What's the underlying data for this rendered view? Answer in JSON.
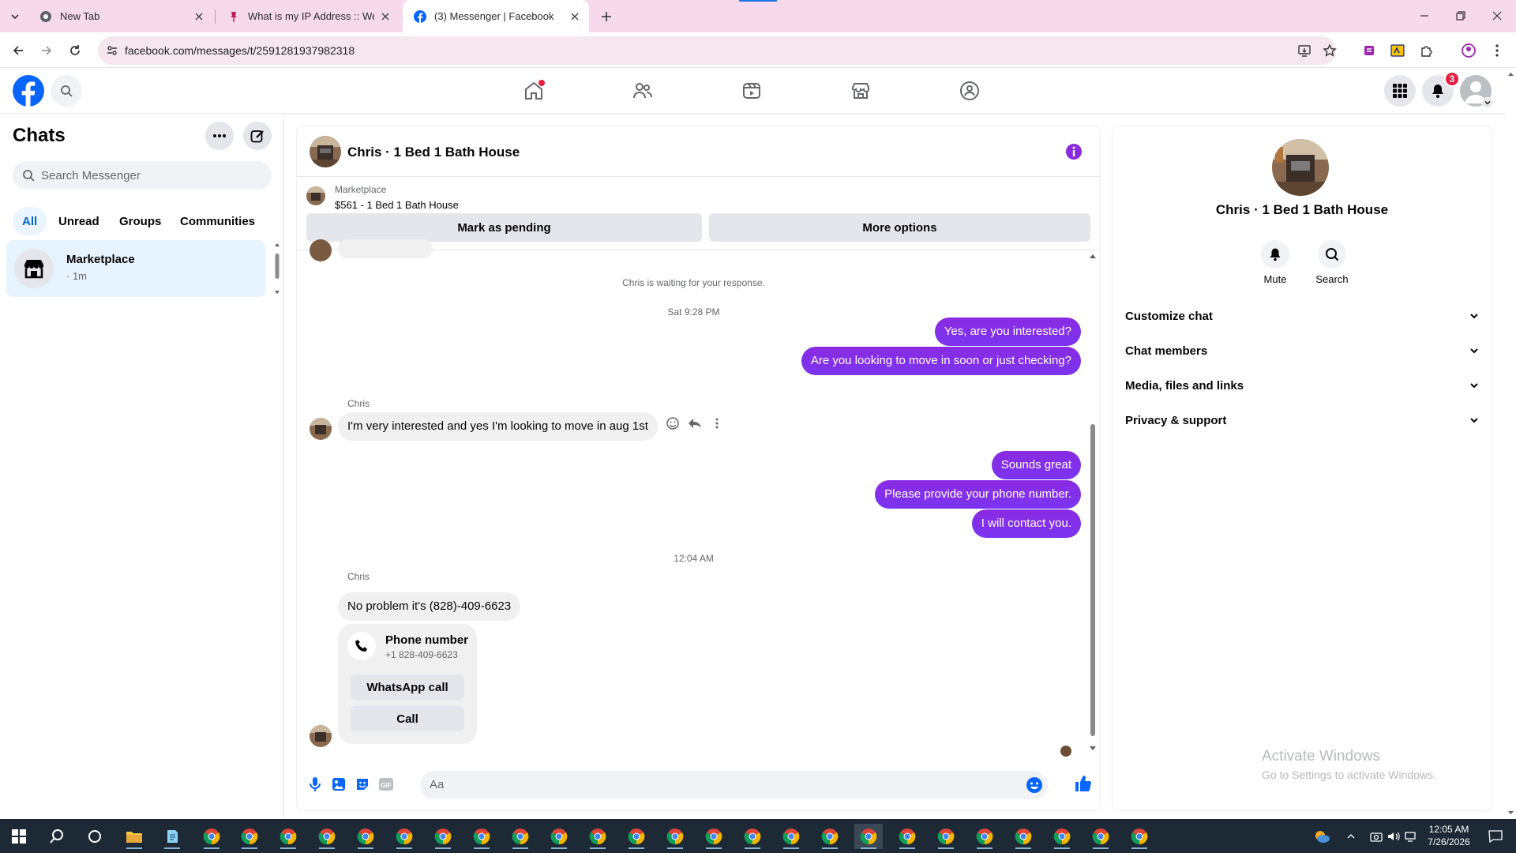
{
  "browser": {
    "tabs": [
      {
        "title": "New Tab",
        "icon": "chrome-icon",
        "active": false
      },
      {
        "title": "What is my IP Address :: WebBr",
        "icon": "pin-icon",
        "active": false
      },
      {
        "title": "(3) Messenger | Facebook",
        "icon": "facebook-icon",
        "active": true
      }
    ],
    "url": "facebook.com/messages/t/2591281937982318"
  },
  "header": {
    "notifications_count": "3",
    "nav_items": [
      "home-icon",
      "friends-icon",
      "video-icon",
      "marketplace-icon",
      "groups-icon"
    ]
  },
  "sidebar": {
    "title": "Chats",
    "search_placeholder": "Search Messenger",
    "filters": [
      "All",
      "Unread",
      "Groups",
      "Communities"
    ],
    "chats": [
      {
        "name": "Marketplace",
        "subtitle": "· 1m"
      }
    ]
  },
  "conversation": {
    "title": "Chris · 1 Bed 1 Bath House",
    "marketplace_label": "Marketplace",
    "listing": "$561 - 1 Bed 1 Bath House",
    "mark_pending": "Mark as pending",
    "more_options": "More options",
    "waiting_notice": "Chris is waiting for your response.",
    "time_1": "Sat 9:28 PM",
    "time_2": "12:04 AM",
    "out_1": "Yes, are you interested?",
    "out_2": "Are you looking to move in soon or just checking?",
    "sender_1": "Chris",
    "in_1": "I'm very interested and yes I'm looking to move in aug 1st",
    "out_3": "Sounds great",
    "out_4": "Please provide your phone number.",
    "out_5": "I will contact you.",
    "sender_2": "Chris",
    "in_2": "No problem it's (828)-409-6623",
    "phone_card": {
      "title": "Phone number",
      "number": "+1 828-409-6623",
      "whatsapp": "WhatsApp call",
      "call": "Call"
    },
    "input_placeholder": "Aa"
  },
  "details": {
    "name": "Chris · 1 Bed 1 Bath House",
    "mute": "Mute",
    "search": "Search",
    "sections": [
      "Customize chat",
      "Chat members",
      "Media, files and links",
      "Privacy & support"
    ]
  },
  "watermark": {
    "line1": "Activate Windows",
    "line2": "Go to Settings to activate Windows."
  },
  "taskbar": {
    "time": "12:05 AM",
    "date": "7/26/2026"
  },
  "colors": {
    "accent": "#0866ff",
    "bubble_out": "#7b2ff7",
    "tabstrip": "#f6d9ea"
  }
}
